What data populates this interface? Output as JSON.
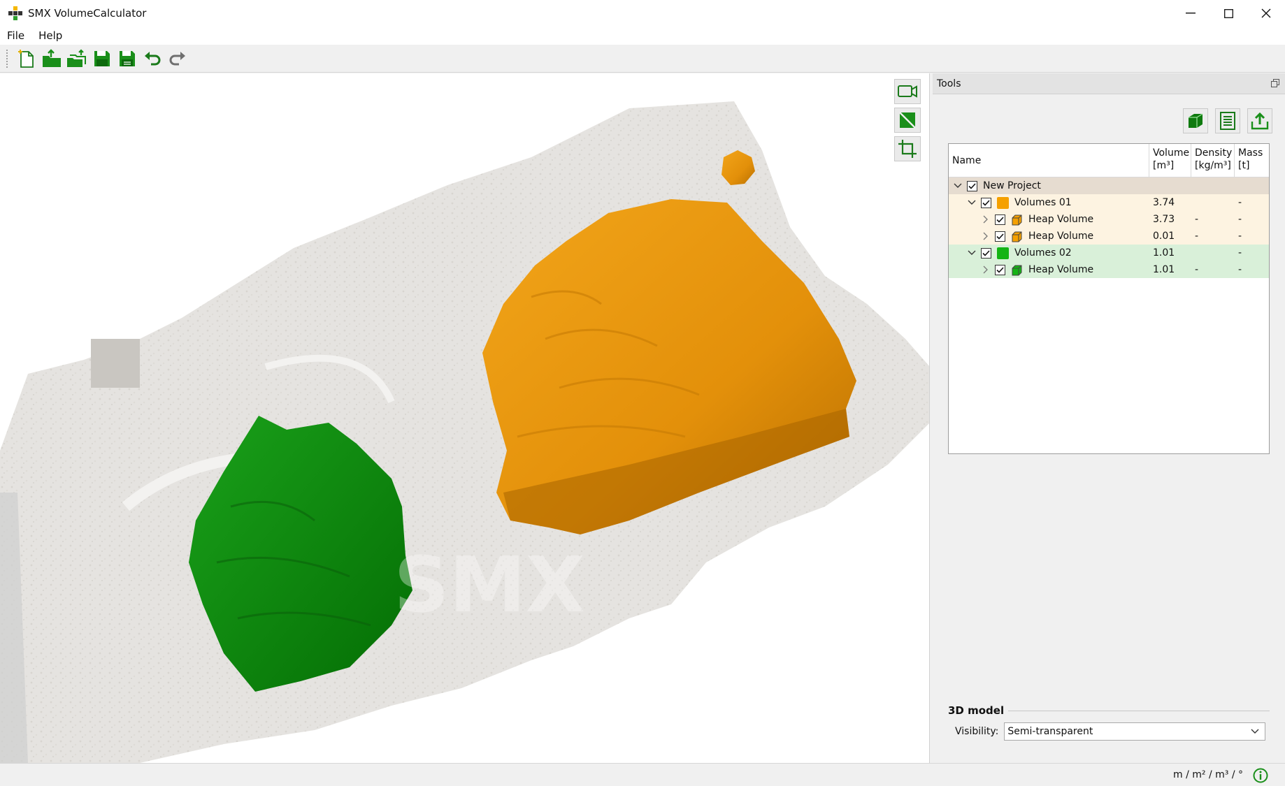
{
  "window": {
    "title": "SMX VolumeCalculator",
    "minimize": "—",
    "maximize": "☐",
    "close": "✕"
  },
  "menu": [
    {
      "label": "File"
    },
    {
      "label": "Help"
    }
  ],
  "toolbar": {
    "buttons": [
      {
        "icon": "new-project-icon"
      },
      {
        "icon": "open-folder-icon"
      },
      {
        "icon": "open-multiple-icon"
      },
      {
        "icon": "save-icon"
      },
      {
        "icon": "save-as-icon"
      },
      {
        "icon": "undo-icon"
      },
      {
        "icon": "redo-icon"
      }
    ]
  },
  "viewport": {
    "tools": [
      {
        "icon": "camera-icon"
      },
      {
        "icon": "draw-polygon-icon"
      },
      {
        "icon": "crop-icon"
      }
    ],
    "watermark": "SMX"
  },
  "panel": {
    "title": "Tools",
    "actions": [
      {
        "icon": "cube-icon"
      },
      {
        "icon": "list-report-icon"
      },
      {
        "icon": "export-icon"
      }
    ],
    "table": {
      "headers": {
        "name": "Name",
        "volume": "Volume",
        "volume_unit": "[m³]",
        "density": "Density",
        "density_unit": "[kg/m³]",
        "mass": "Mass",
        "mass_unit": "[t]"
      },
      "rows": [
        {
          "name": "New Project",
          "volume": "",
          "density": "",
          "mass": "",
          "level": 0,
          "kind": "project",
          "bg": "#e6dcd0"
        },
        {
          "name": "Volumes 01",
          "volume": "3.74",
          "density": "",
          "mass": "-",
          "level": 1,
          "kind": "group",
          "color": "#f5a000",
          "bg": "#fdf3e1"
        },
        {
          "name": "Heap Volume",
          "volume": "3.73",
          "density": "-",
          "mass": "-",
          "level": 2,
          "kind": "item",
          "color": "#f5a000",
          "bg": "#fdf3e1"
        },
        {
          "name": "Heap Volume",
          "volume": "0.01",
          "density": "-",
          "mass": "-",
          "level": 2,
          "kind": "item",
          "color": "#f5a000",
          "bg": "#fdf3e1"
        },
        {
          "name": "Volumes 02",
          "volume": "1.01",
          "density": "",
          "mass": "-",
          "level": 1,
          "kind": "group",
          "color": "#14b414",
          "bg": "#d9f0d9"
        },
        {
          "name": "Heap Volume",
          "volume": "1.01",
          "density": "-",
          "mass": "-",
          "level": 2,
          "kind": "item",
          "color": "#14b414",
          "bg": "#d9f0d9"
        }
      ]
    },
    "model": {
      "section": "3D model",
      "visibility_label": "Visibility:",
      "visibility_value": "Semi-transparent"
    }
  },
  "status": {
    "units": "m / m² / m³ / °"
  },
  "colors": {
    "orange": "#e8960a",
    "green": "#0a8f0a",
    "accent_green": "#1f9d1f"
  }
}
